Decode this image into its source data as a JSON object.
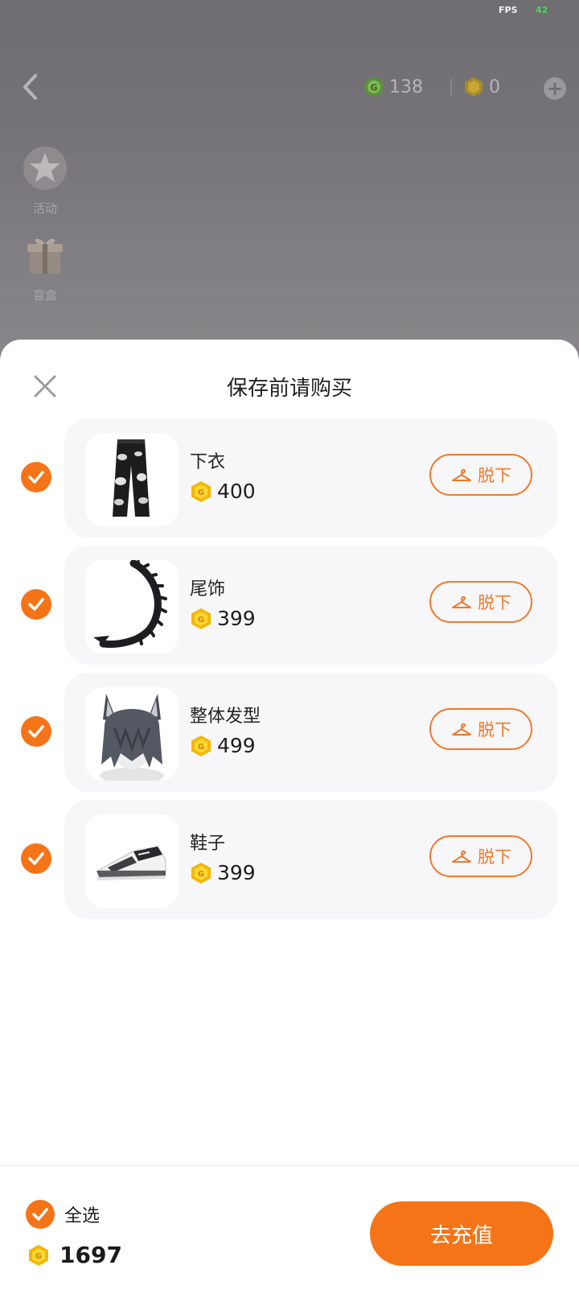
{
  "status": {
    "fps_label": "FPS",
    "fps_value": "42"
  },
  "topbar": {
    "currency_green": {
      "icon": "green-gem-coin-icon",
      "value": "138"
    },
    "currency_gold": {
      "icon": "gold-coin-icon",
      "value": "0"
    },
    "add_icon": "plus-icon"
  },
  "side_menu": [
    {
      "label": "活动",
      "icon": "star-badge-icon"
    },
    {
      "label": "盲盒",
      "icon": "gift-box-icon"
    }
  ],
  "sheet": {
    "title": "保存前请购买",
    "close_icon": "close-icon",
    "items": [
      {
        "name": "下衣",
        "price": "400",
        "action": "脱下",
        "checked": true,
        "thumb": "pants-image"
      },
      {
        "name": "尾饰",
        "price": "399",
        "action": "脱下",
        "checked": true,
        "thumb": "tail-image"
      },
      {
        "name": "整体发型",
        "price": "499",
        "action": "脱下",
        "checked": true,
        "thumb": "hairstyle-image"
      },
      {
        "name": "鞋子",
        "price": "399",
        "action": "脱下",
        "checked": true,
        "thumb": "shoes-image"
      }
    ]
  },
  "footer": {
    "select_all_label": "全选",
    "select_all_checked": true,
    "total": "1697",
    "recharge_label": "去充值"
  },
  "colors": {
    "accent": "#f57418",
    "coin_gold": "#f5c518",
    "card_bg": "#f7f6f9"
  }
}
